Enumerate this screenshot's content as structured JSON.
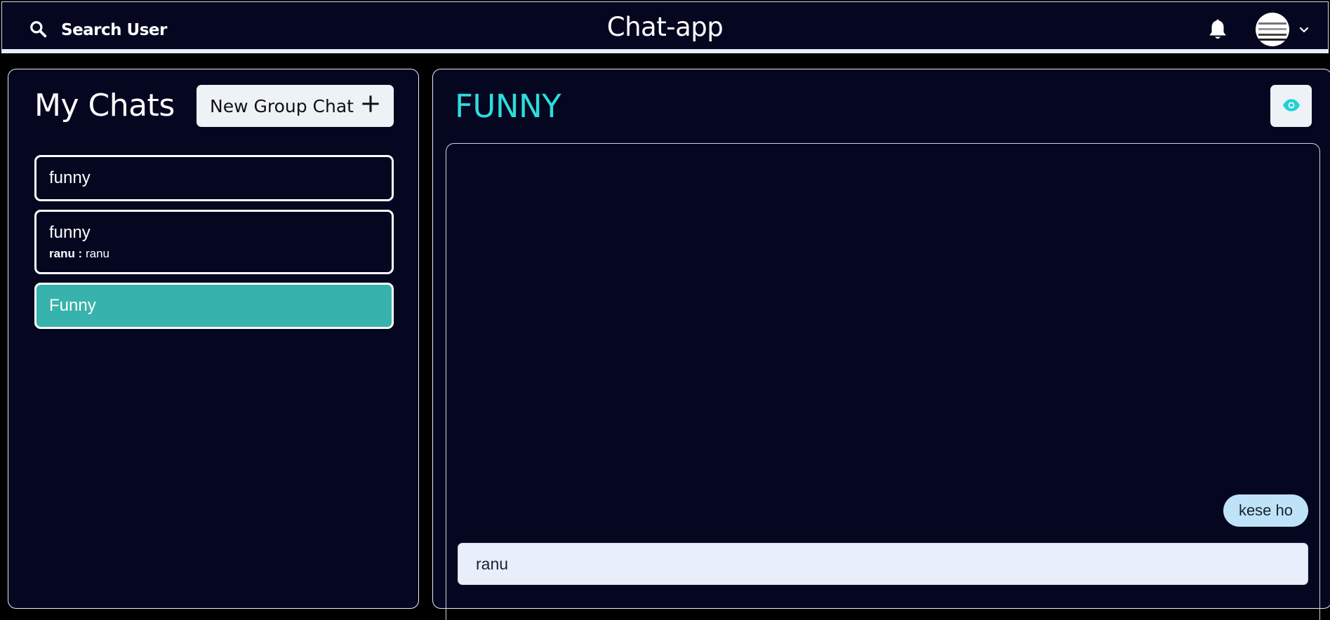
{
  "topbar": {
    "search_label": "Search User",
    "app_title": "Chat-app"
  },
  "sidebar": {
    "title": "My Chats",
    "new_group_label": "New Group Chat",
    "chats": [
      {
        "name": "funny"
      },
      {
        "name": "funny",
        "latest_sender": "ranu :",
        "latest_message": "ranu"
      },
      {
        "name": "Funny",
        "active": true
      }
    ]
  },
  "chat": {
    "title": "FUNNY",
    "messages": [
      {
        "text": "kese ho"
      }
    ],
    "input_value": "ranu"
  },
  "colors": {
    "background": "#050720",
    "accent": "#38b2ac",
    "title_cyan": "#2edcdc",
    "bubble": "#bee3f8",
    "button_bg": "#edf2f7"
  },
  "icons": [
    "search-icon",
    "bell-icon",
    "chevron-down-icon",
    "plus-icon",
    "eye-icon"
  ]
}
